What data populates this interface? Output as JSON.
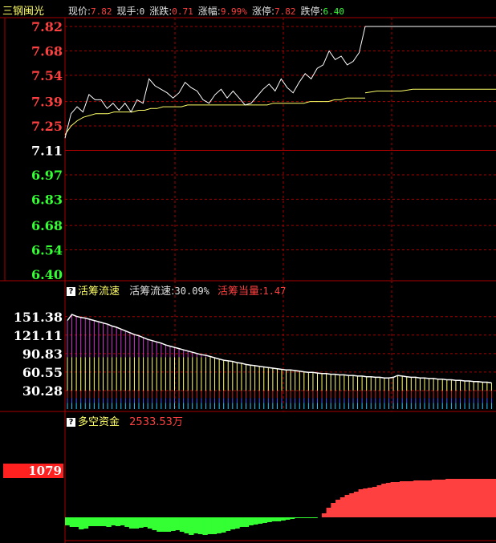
{
  "header": {
    "stock_name": "三钢闽光",
    "quote_items": [
      {
        "label": "现价:",
        "value": "7.82",
        "color": "#ff4040"
      },
      {
        "label": "现手:",
        "value": "0",
        "color": "#e0e0e0"
      },
      {
        "label": "涨跌:",
        "value": "0.71",
        "color": "#ff4040"
      },
      {
        "label": "涨幅:",
        "value": "9.99%",
        "color": "#ff4040"
      },
      {
        "label": "涨停:",
        "value": "7.82",
        "color": "#ff4040"
      },
      {
        "label": "跌停:",
        "value": "6.40",
        "color": "#33ff33"
      }
    ]
  },
  "panel2_header": {
    "icon": "question-icon",
    "name": "活筹流速",
    "metric_label": "活筹流速:",
    "metric_value": "30.09%",
    "equiv_label": "活筹当量:",
    "equiv_value": "1.47"
  },
  "panel3_header": {
    "icon": "question-icon",
    "name": "多空资金",
    "value": "2533.53万"
  },
  "panel3_badge": "1079",
  "colors": {
    "up": "#ff4040",
    "down": "#33ff33",
    "grid": "#aa0000",
    "price_line": "#ffffff",
    "avg_line": "#ffff66",
    "magenta": "#cc33cc",
    "yellow_bar": "#ffff66"
  },
  "chart_data": [
    {
      "type": "line",
      "name": "price",
      "y_ticks": [
        "7.82",
        "7.68",
        "7.54",
        "7.39",
        "7.25",
        "7.11",
        "6.97",
        "6.83",
        "6.68",
        "6.54",
        "6.40"
      ],
      "ylim": [
        6.4,
        7.82
      ],
      "prev_close": 7.11,
      "series": [
        {
          "name": "price",
          "values": [
            7.18,
            7.32,
            7.36,
            7.33,
            7.43,
            7.4,
            7.4,
            7.35,
            7.38,
            7.34,
            7.38,
            7.33,
            7.4,
            7.38,
            7.52,
            7.48,
            7.46,
            7.44,
            7.41,
            7.44,
            7.5,
            7.47,
            7.45,
            7.4,
            7.38,
            7.43,
            7.46,
            7.41,
            7.45,
            7.41,
            7.37,
            7.38,
            7.42,
            7.46,
            7.49,
            7.45,
            7.52,
            7.47,
            7.44,
            7.5,
            7.55,
            7.52,
            7.58,
            7.6,
            7.68,
            7.63,
            7.65,
            7.6,
            7.62,
            7.67,
            7.82,
            7.82,
            7.82,
            7.82,
            7.82,
            7.82,
            7.82,
            7.82,
            7.82,
            7.82,
            7.82,
            7.82
          ]
        },
        {
          "name": "avg",
          "values": [
            7.2,
            7.25,
            7.28,
            7.3,
            7.31,
            7.32,
            7.32,
            7.32,
            7.33,
            7.33,
            7.33,
            7.33,
            7.34,
            7.34,
            7.35,
            7.35,
            7.36,
            7.36,
            7.36,
            7.36,
            7.37,
            7.37,
            7.37,
            7.37,
            7.37,
            7.37,
            7.37,
            7.37,
            7.37,
            7.37,
            7.37,
            7.37,
            7.37,
            7.37,
            7.38,
            7.38,
            7.38,
            7.38,
            7.38,
            7.38,
            7.39,
            7.39,
            7.39,
            7.39,
            7.4,
            7.4,
            7.41,
            7.41,
            7.41,
            7.41,
            7.44,
            7.45,
            7.45,
            7.45,
            7.46,
            7.46,
            7.46,
            7.46,
            7.46,
            7.46,
            7.46,
            7.46
          ]
        }
      ]
    },
    {
      "type": "bar",
      "name": "活筹流速",
      "y_ticks": [
        "151.38",
        "121.11",
        "90.83",
        "60.55",
        "30.28"
      ],
      "ylim": [
        0,
        155
      ],
      "series": [
        {
          "name": "envelope",
          "values": [
            145,
            155,
            152,
            150,
            149,
            147,
            145,
            143,
            141,
            139,
            136,
            134,
            131,
            128,
            125,
            122,
            120,
            117,
            114,
            112,
            110,
            108,
            105,
            103,
            101,
            99,
            97,
            95,
            93,
            91,
            89,
            88,
            86,
            84,
            82,
            80,
            79,
            78,
            76,
            75,
            73,
            72,
            71,
            70,
            69,
            68,
            67,
            66,
            65,
            64,
            64,
            63,
            62,
            61,
            60,
            60,
            59,
            58,
            58,
            57,
            57,
            56,
            56,
            55,
            55,
            54,
            54,
            53,
            53,
            52,
            52,
            51,
            51,
            52,
            55,
            54,
            53,
            52,
            52,
            51,
            51,
            50,
            50,
            49,
            49,
            48,
            48,
            47,
            47,
            46,
            46,
            45,
            45,
            44,
            44,
            43
          ]
        }
      ]
    },
    {
      "type": "bar",
      "name": "多空资金",
      "series": [
        {
          "name": "flow",
          "values": [
            -10,
            -12,
            -12,
            -15,
            -14,
            -11,
            -11,
            -11,
            -11,
            -12,
            -10,
            -11,
            -10,
            -12,
            -14,
            -14,
            -13,
            -12,
            -14,
            -16,
            -18,
            -18,
            -18,
            -17,
            -16,
            -18,
            -20,
            -22,
            -20,
            -21,
            -22,
            -21,
            -21,
            -20,
            -19,
            -17,
            -15,
            -14,
            -12,
            -12,
            -10,
            -9,
            -8,
            -7,
            -6,
            -5,
            -5,
            -4,
            -3,
            -2,
            -1,
            -1,
            -1,
            -1,
            -1,
            0,
            5,
            12,
            18,
            22,
            25,
            28,
            30,
            32,
            35,
            36,
            37,
            38,
            40,
            42,
            43,
            44,
            44,
            45,
            45,
            45,
            46,
            46,
            46,
            46,
            47,
            47,
            47,
            48,
            48,
            48,
            48,
            48,
            48,
            48,
            48,
            48,
            48,
            48
          ]
        }
      ]
    }
  ]
}
